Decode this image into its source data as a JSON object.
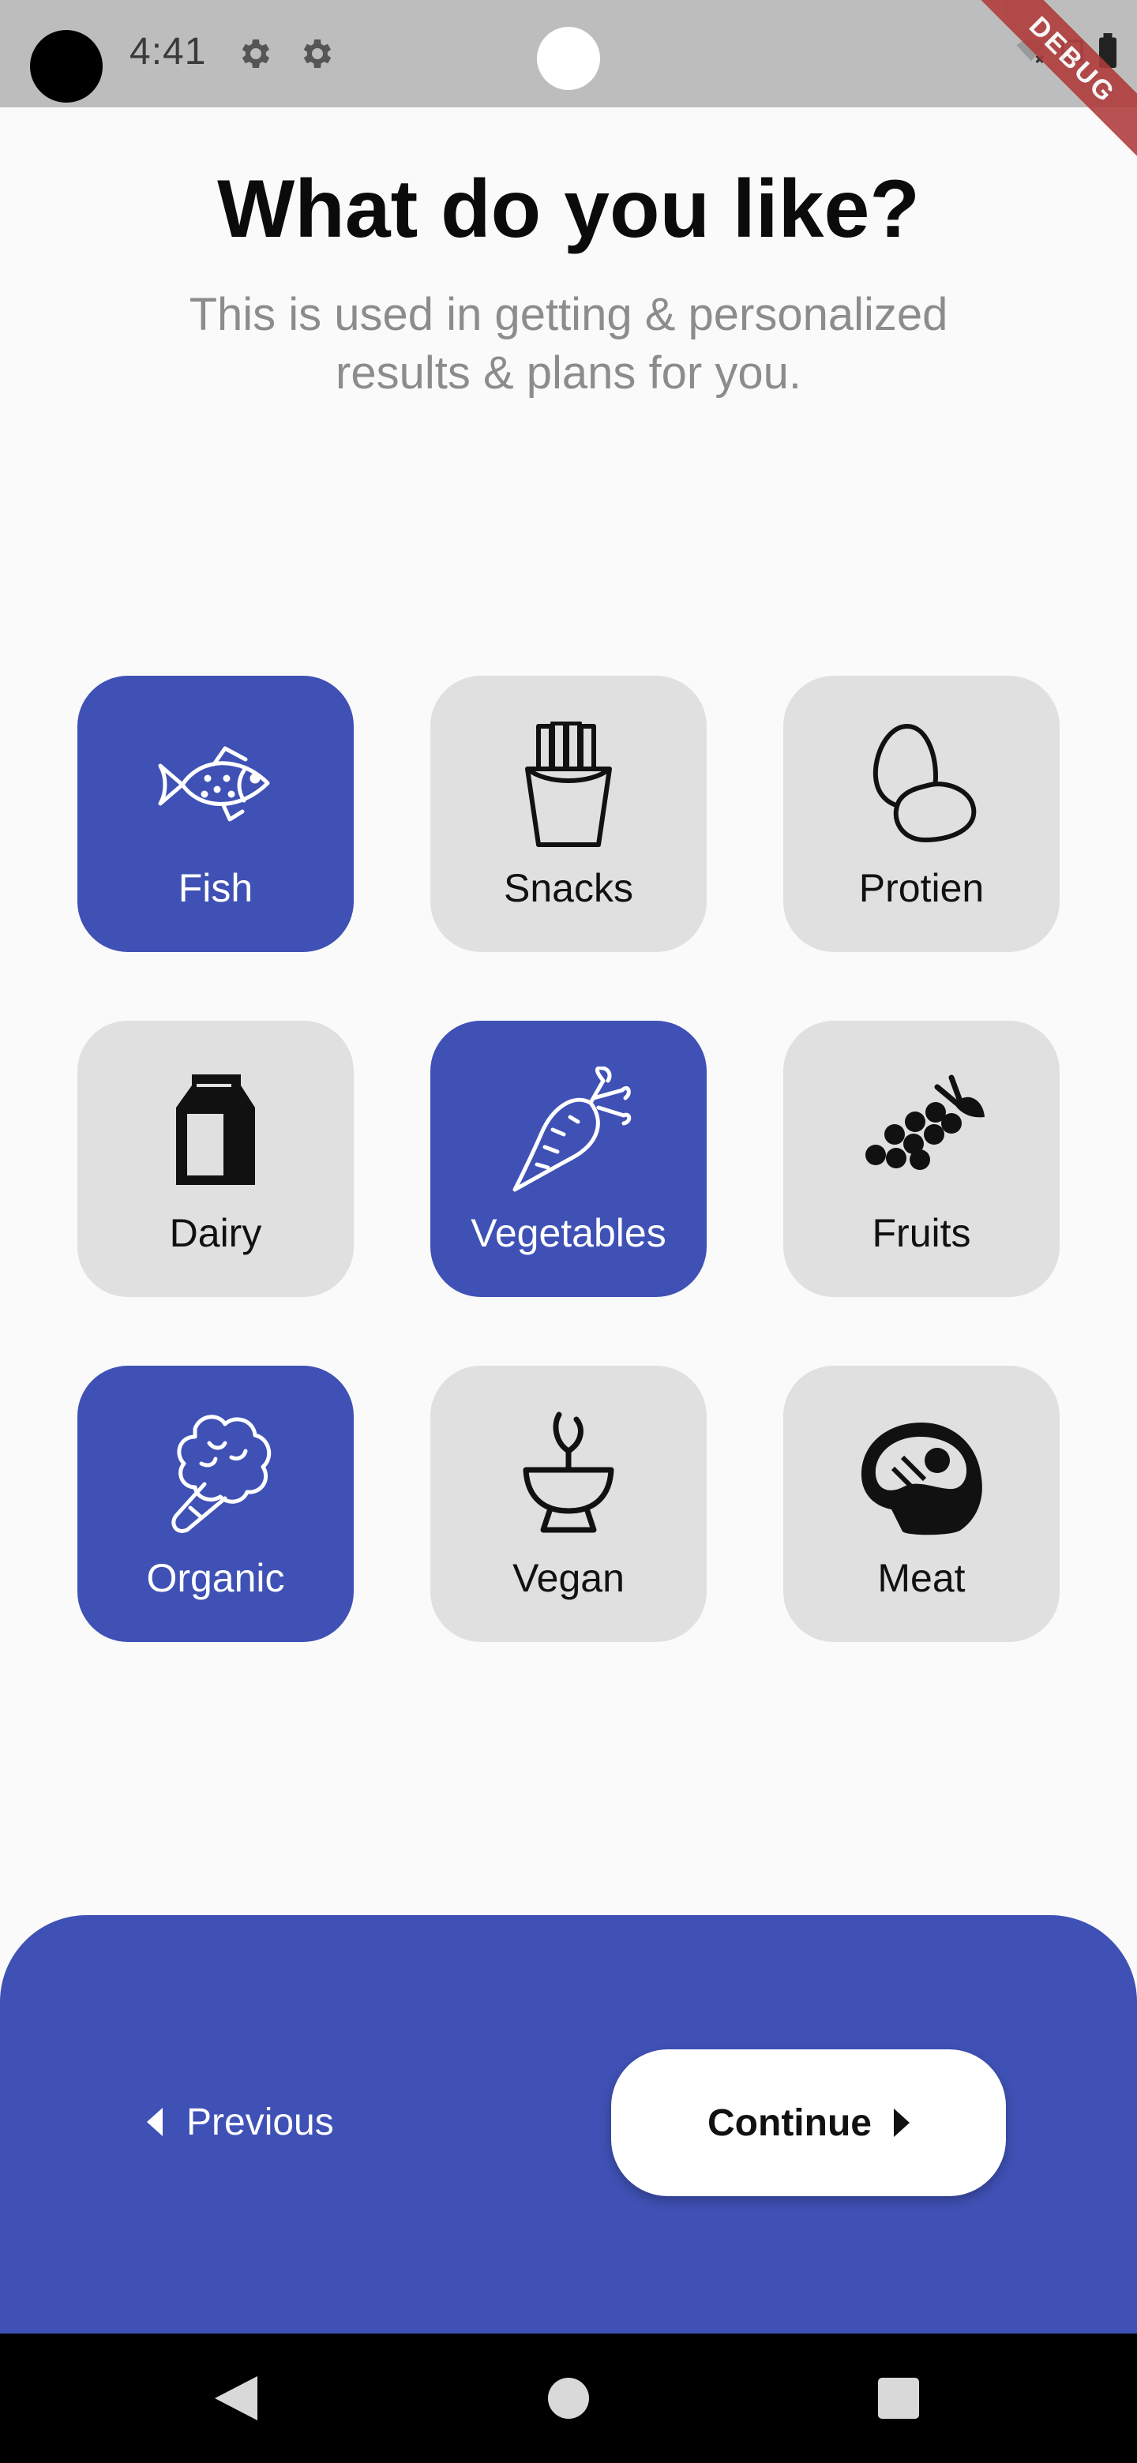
{
  "status_bar": {
    "time": "4:41",
    "debug_label": "DEBUG",
    "background": "#bdbdbd"
  },
  "header": {
    "title": "What do you like?",
    "subtitle": "This is used in getting & personalized results & plans for you."
  },
  "colors": {
    "accent": "#3f51b5",
    "tile_unselected": "#e0e0e0",
    "subtitle_gray": "#8c8c8c"
  },
  "categories": [
    {
      "label": "Fish",
      "icon": "fish-icon",
      "selected": true
    },
    {
      "label": "Snacks",
      "icon": "fries-icon",
      "selected": false
    },
    {
      "label": "Protien",
      "icon": "eggs-icon",
      "selected": false
    },
    {
      "label": "Dairy",
      "icon": "milk-carton-icon",
      "selected": false
    },
    {
      "label": "Vegetables",
      "icon": "carrot-icon",
      "selected": true
    },
    {
      "label": "Fruits",
      "icon": "grapes-icon",
      "selected": false
    },
    {
      "label": "Organic",
      "icon": "broccoli-icon",
      "selected": true
    },
    {
      "label": "Vegan",
      "icon": "vegan-bowl-icon",
      "selected": false
    },
    {
      "label": "Meat",
      "icon": "steak-icon",
      "selected": false
    }
  ],
  "footer": {
    "previous_label": "Previous",
    "continue_label": "Continue"
  }
}
